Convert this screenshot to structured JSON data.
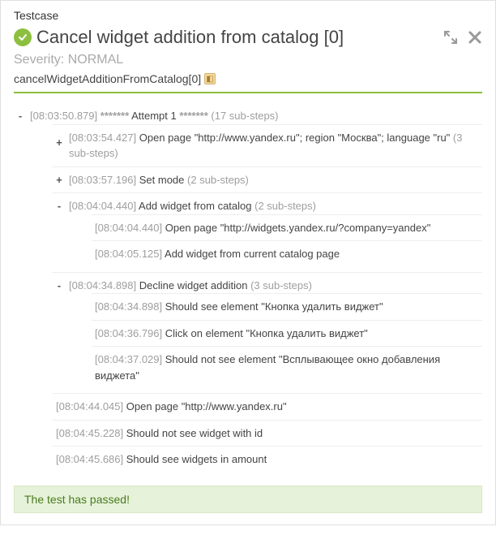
{
  "panel": {
    "label": "Testcase",
    "title": "Cancel widget addition from catalog [0]",
    "severity": "Severity: NORMAL",
    "method": "cancelWidgetAdditionFromCatalog[0]",
    "result": "The test has passed!"
  },
  "attempt": {
    "ts": "[08:03:50.879]",
    "stars": "*******",
    "label": "Attempt 1",
    "sub": "(17 sub-steps)"
  },
  "steps": [
    {
      "toggle": "+",
      "toggleLow": true,
      "ts": "[08:03:54.427]",
      "label": "Open page \"http://www.yandex.ru\"; region \"Москва\"; language \"ru\"",
      "sub": "(3 sub-steps)"
    },
    {
      "toggle": "+",
      "ts": "[08:03:57.196]",
      "label": "Set mode",
      "sub": "(2 sub-steps)"
    },
    {
      "toggle": "-",
      "ts": "[08:04:04.440]",
      "label": "Add widget from catalog",
      "sub": "(2 sub-steps)",
      "children": [
        {
          "ts": "[08:04:04.440]",
          "label": "Open page \"http://widgets.yandex.ru/?company=yandex\""
        },
        {
          "ts": "[08:04:05.125]",
          "label": "Add widget from current catalog page"
        }
      ]
    },
    {
      "toggle": "-",
      "ts": "[08:04:34.898]",
      "label": "Decline widget addition",
      "sub": "(3 sub-steps)",
      "children": [
        {
          "ts": "[08:04:34.898]",
          "label": "Should see element \"Кнопка удалить виджет\""
        },
        {
          "ts": "[08:04:36.796]",
          "label": "Click on element \"Кнопка удалить виджет\""
        },
        {
          "ts": "[08:04:37.029]",
          "label": "Should not see element \"Всплывающее окно добавления виджета\""
        }
      ]
    },
    {
      "ts": "[08:04:44.045]",
      "label": "Open page \"http://www.yandex.ru\""
    },
    {
      "ts": "[08:04:45.228]",
      "label": "Should not see widget with id"
    },
    {
      "ts": "[08:04:45.686]",
      "label": "Should see widgets in amount"
    }
  ]
}
